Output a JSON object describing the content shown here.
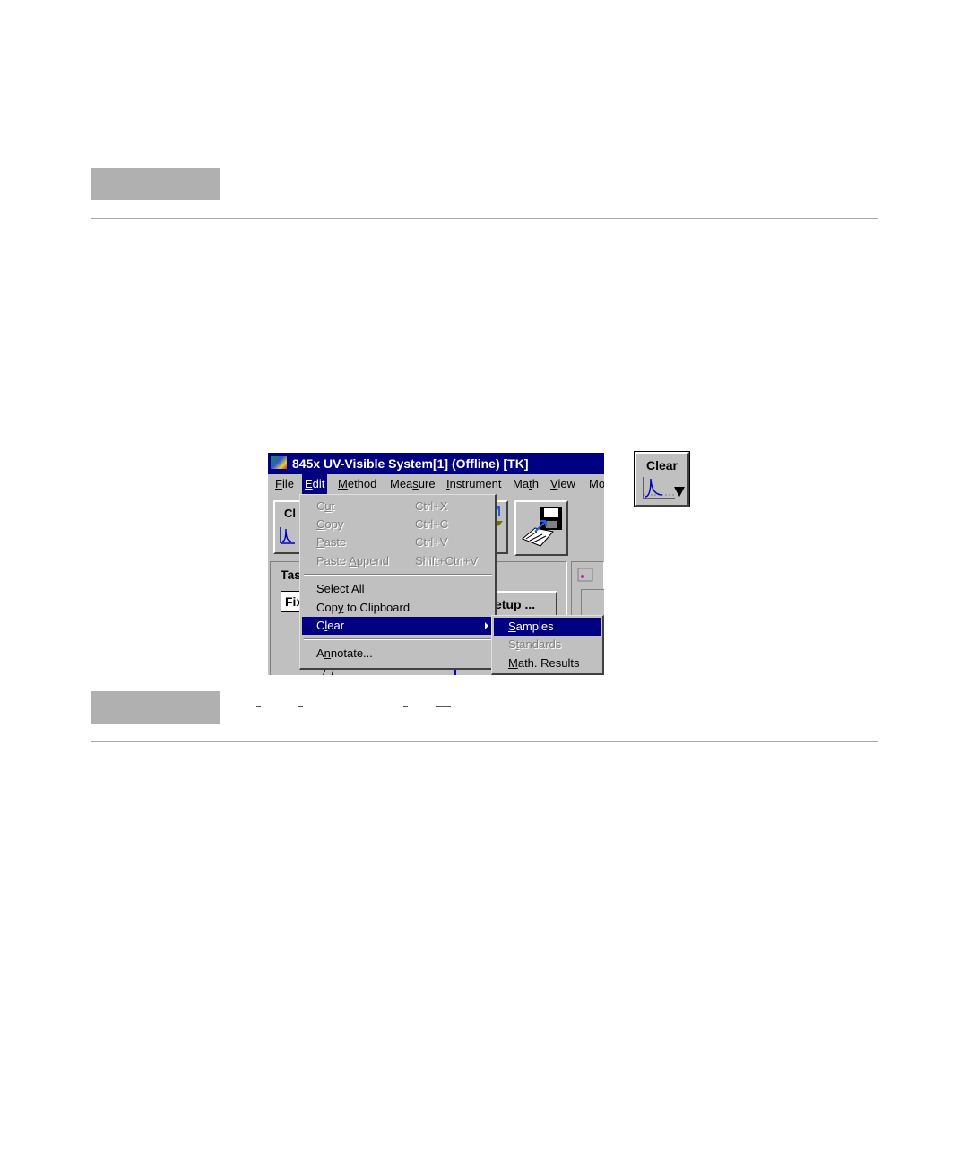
{
  "window": {
    "title": "845x UV-Visible System[1] (Offline) [TK]",
    "menu": [
      {
        "pre": "",
        "key": "F",
        "post": "ile"
      },
      {
        "pre": "",
        "key": "E",
        "post": "dit"
      },
      {
        "pre": "",
        "key": "M",
        "post": "ethod"
      },
      {
        "pre": "Mea",
        "key": "s",
        "post": "ure"
      },
      {
        "pre": "",
        "key": "I",
        "post": "nstrument"
      },
      {
        "pre": "Ma",
        "key": "t",
        "post": "h"
      },
      {
        "pre": "",
        "key": "V",
        "post": "iew"
      },
      {
        "pre": "M",
        "key": "",
        "post": "o"
      }
    ],
    "partial": {
      "toolbar_clear": "Cl",
      "task_label": "Tas",
      "task_field": "Fix",
      "setup_button": "etup ..."
    }
  },
  "edit_menu": {
    "cut": {
      "pre": "C",
      "key": "u",
      "post": "t",
      "shortcut": "Ctrl+X"
    },
    "copy": {
      "pre": "",
      "key": "C",
      "post": "opy",
      "shortcut": "Ctrl+C"
    },
    "paste": {
      "pre": "",
      "key": "P",
      "post": "aste",
      "shortcut": "Ctrl+V"
    },
    "paste_append": {
      "pre": "Paste ",
      "key": "A",
      "post": "ppend",
      "shortcut": "Shift+Ctrl+V"
    },
    "select_all": {
      "pre": "",
      "key": "S",
      "post": "elect All"
    },
    "copy_clipboard": {
      "pre": "Cop",
      "key": "y",
      "post": " to Clipboard"
    },
    "clear": {
      "pre": "C",
      "key": "l",
      "post": "ear"
    },
    "annotate": {
      "pre": "A",
      "key": "n",
      "post": "notate..."
    }
  },
  "clear_submenu": {
    "samples": {
      "pre": "",
      "key": "S",
      "post": "amples"
    },
    "standards": {
      "pre": "S",
      "key": "t",
      "post": "andards"
    },
    "math_results": {
      "pre": "",
      "key": "M",
      "post": "ath. Results"
    }
  },
  "clear_button": {
    "label": "Clear"
  }
}
